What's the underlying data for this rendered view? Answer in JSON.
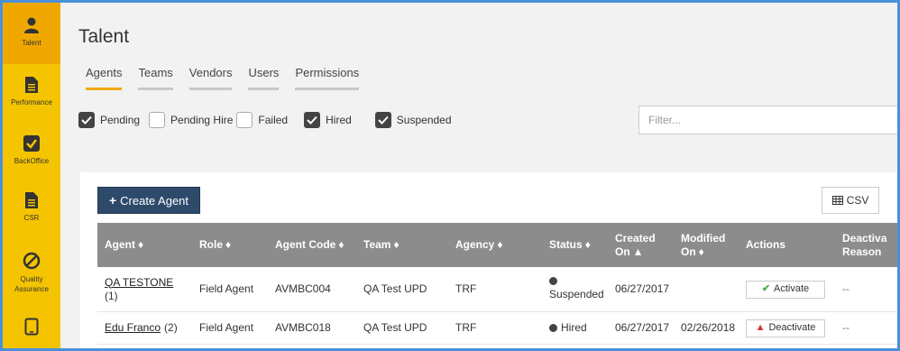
{
  "sidebar": {
    "items": [
      {
        "label": "Talent",
        "icon": "person-icon",
        "active": true
      },
      {
        "label": "Performance",
        "icon": "document-icon"
      },
      {
        "label": "BackOffice",
        "icon": "checkbox-icon"
      },
      {
        "label": "CSR",
        "icon": "document-icon"
      },
      {
        "label": "Quality Assurance",
        "icon": "no-entry-icon"
      },
      {
        "label": "",
        "icon": "tablet-icon"
      }
    ]
  },
  "page": {
    "title": "Talent"
  },
  "tabs": [
    {
      "label": "Agents",
      "active": true
    },
    {
      "label": "Teams"
    },
    {
      "label": "Vendors"
    },
    {
      "label": "Users"
    },
    {
      "label": "Permissions"
    }
  ],
  "filters": {
    "checkboxes": [
      {
        "label": "Pending",
        "checked": true
      },
      {
        "label": "Pending Hire",
        "checked": false
      },
      {
        "label": "Failed",
        "checked": false
      },
      {
        "label": "Hired",
        "checked": true
      },
      {
        "label": "Suspended",
        "checked": true
      }
    ],
    "filter_placeholder": "Filter..."
  },
  "toolbar": {
    "create_label": "Create Agent",
    "csv_label": "CSV"
  },
  "table": {
    "headers": {
      "agent": "Agent",
      "role": "Role",
      "agent_code": "Agent Code",
      "team": "Team",
      "agency": "Agency",
      "status": "Status",
      "created_1": "Created",
      "created_2": "On",
      "modified_1": "Modified",
      "modified_2": "On",
      "actions": "Actions",
      "deact_1": "Deactiva",
      "deact_2": "Reason"
    },
    "rows": [
      {
        "name": "QA TESTONE",
        "count": "(1)",
        "role": "Field Agent",
        "code": "AVMBC004",
        "team": "QA Test UPD",
        "agency": "TRF",
        "status": "Suspended",
        "created": "06/27/2017",
        "modified": "",
        "action": "Activate",
        "reason": "--"
      },
      {
        "name": "Edu Franco",
        "count": "(2)",
        "role": "Field Agent",
        "code": "AVMBC018",
        "team": "QA Test UPD",
        "agency": "TRF",
        "status": "Hired",
        "created": "06/27/2017",
        "modified": "02/26/2018",
        "action": "Deactivate",
        "reason": "--"
      }
    ]
  },
  "colors": {
    "sidebar": "#f5c400",
    "sidebar_active": "#f0a800",
    "tab_active_underline": "#f0a800",
    "primary_button": "#2e4a6b",
    "table_header": "#8c8c8c",
    "activate_check": "#4caf50",
    "deactivate_warning": "#d9302b"
  }
}
